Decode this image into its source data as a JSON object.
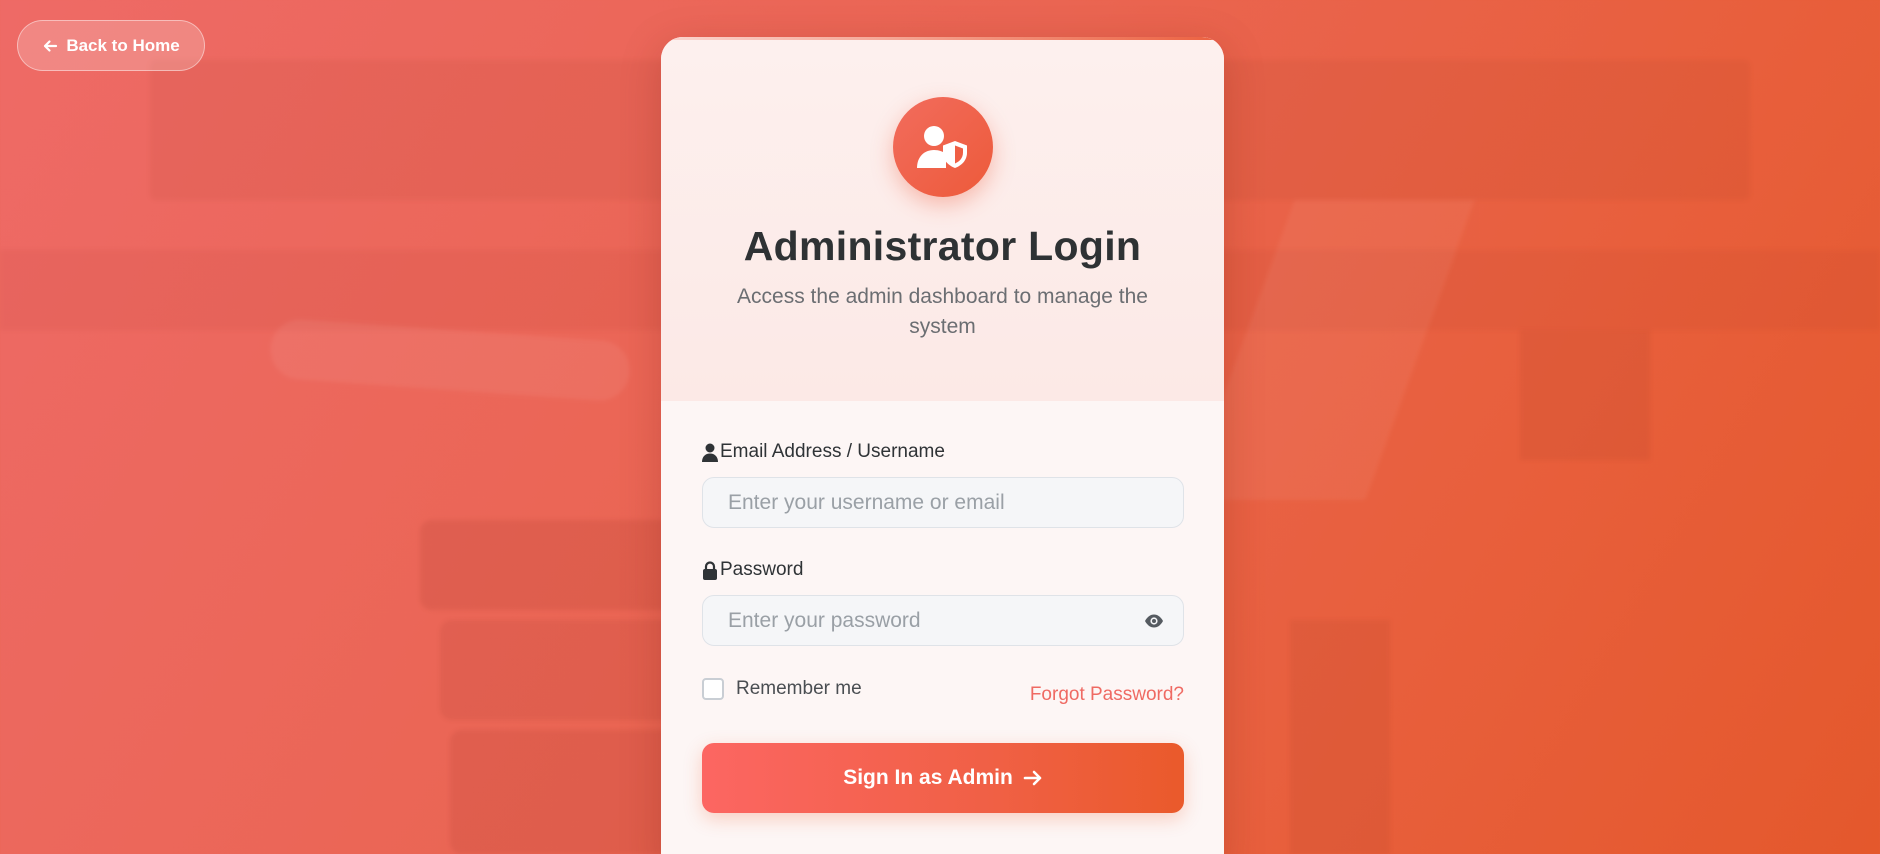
{
  "back_button": {
    "label": "Back to Home",
    "icon": "arrow-left-icon"
  },
  "login_card": {
    "avatar_icon": "user-shield-icon",
    "title": "Administrator Login",
    "subtitle": "Access the admin dashboard to manage the system",
    "email_field": {
      "label": "Email Address / Username",
      "icon": "user-icon",
      "value": "",
      "placeholder": "Enter your username or email"
    },
    "password_field": {
      "label": "Password",
      "icon": "lock-icon",
      "value": "",
      "placeholder": "Enter your password",
      "toggle_icon": "eye-icon"
    },
    "remember_me": {
      "label": "Remember me",
      "checked": false
    },
    "forgot_password": "Forgot Password?",
    "submit_button": {
      "label": "Sign In as Admin",
      "icon": "arrow-right-icon"
    }
  },
  "colors": {
    "background_start": "#ee6a66",
    "background_end": "#e4582c",
    "accent": "#ef6a63",
    "button_start": "#fc6662",
    "button_end": "#ea5a2b",
    "heading": "#2e3234"
  }
}
